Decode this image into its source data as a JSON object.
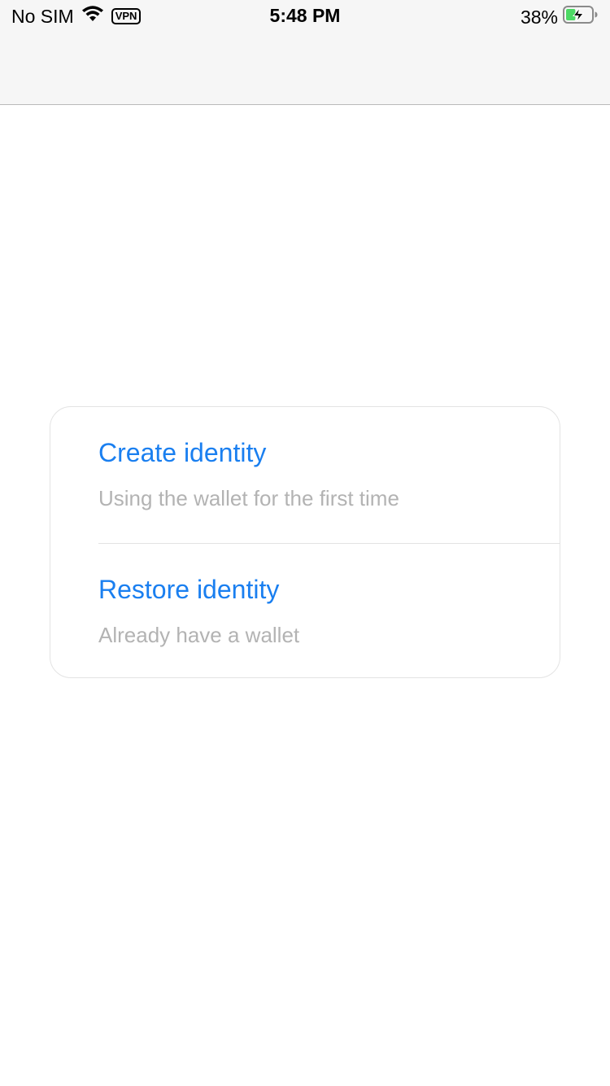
{
  "status_bar": {
    "carrier": "No SIM",
    "vpn": "VPN",
    "time": "5:48 PM",
    "battery_percent": "38%",
    "battery_level": 0.38,
    "battery_charging": true,
    "icons": [
      "wifi-icon",
      "vpn-icon",
      "battery-charging-icon"
    ]
  },
  "options": [
    {
      "title": "Create identity",
      "subtitle": "Using the wallet for the first time"
    },
    {
      "title": "Restore identity",
      "subtitle": "Already have a wallet"
    }
  ],
  "colors": {
    "accent": "#1a7ff0",
    "subtitle": "#b3b3b3",
    "battery_fill": "#4cd964",
    "bar_background": "#f6f6f6"
  }
}
